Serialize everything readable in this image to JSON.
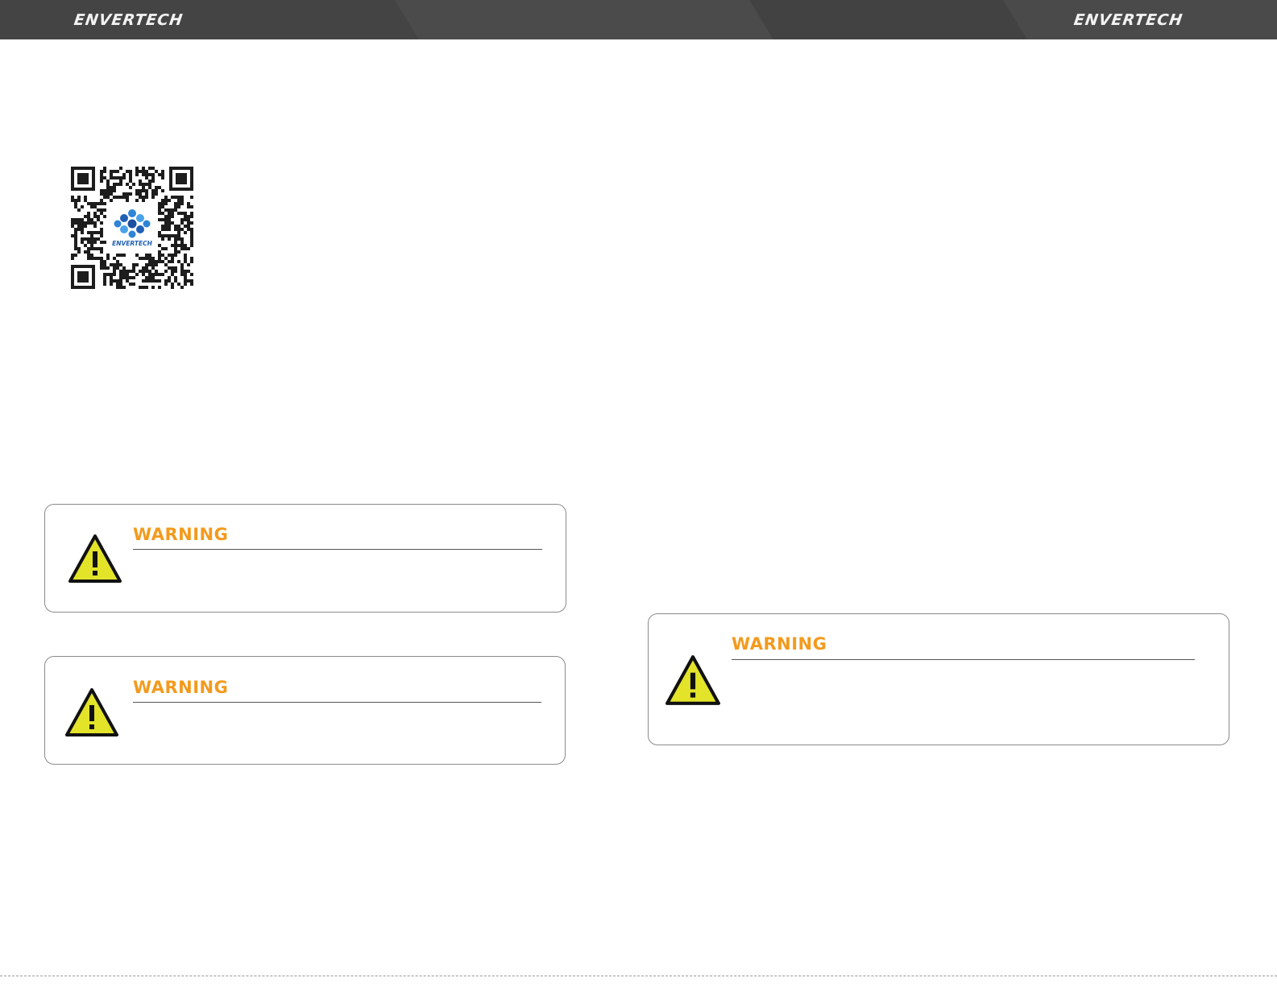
{
  "header": {
    "logo_left": "ENVERTECH",
    "logo_right": "ENVERTECH"
  },
  "qr_code": {
    "center_logo_text": "ENVERTECH"
  },
  "warnings": [
    {
      "title": "WARNING"
    },
    {
      "title": "WARNING"
    },
    {
      "title": "WARNING"
    }
  ],
  "colors": {
    "header_bg": "#474747",
    "warning_title": "#f39a1d",
    "warning_icon_fill": "#e3e32a",
    "box_border": "#8a8a8a"
  }
}
